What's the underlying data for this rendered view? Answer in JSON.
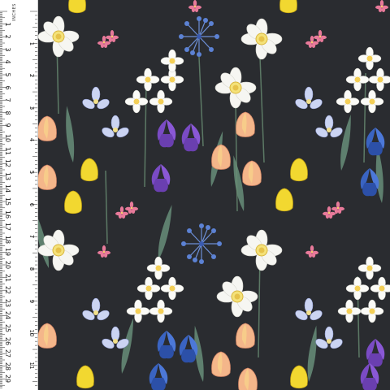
{
  "ruler": {
    "unit_label": "INCHES",
    "cm_labels": [
      "1",
      "2",
      "3",
      "4",
      "5",
      "6",
      "7",
      "8",
      "9",
      "10",
      "11",
      "12",
      "13",
      "14",
      "15",
      "16",
      "17",
      "18",
      "19",
      "20",
      "21",
      "22",
      "23",
      "24",
      "25",
      "26",
      "27",
      "28",
      "29",
      "30"
    ],
    "inch_labels": [
      "1",
      "2",
      "3",
      "4",
      "5",
      "6",
      "7",
      "8",
      "9",
      "10",
      "11",
      "12"
    ]
  },
  "pattern": {
    "background_color": "#2a2c30",
    "motifs": [
      "daffodil",
      "narcissus",
      "tulip",
      "iris",
      "agapanthus",
      "columbine",
      "freesia",
      "leaves"
    ]
  }
}
